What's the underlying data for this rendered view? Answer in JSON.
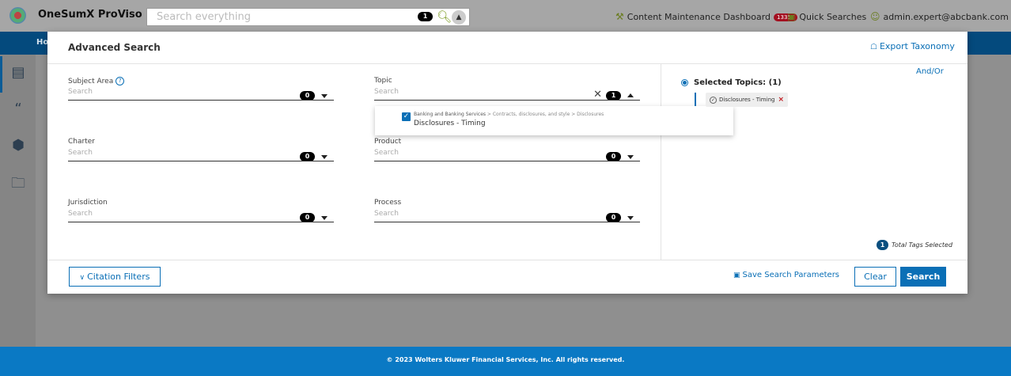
{
  "app": {
    "title": "OneSumX ProViso"
  },
  "global_search": {
    "placeholder": "Search everything",
    "count": "1"
  },
  "topbar": {
    "dashboard_label": "Content Maintenance Dashboard",
    "dashboard_count": "13357",
    "quick_searches_label": "Quick Searches",
    "user_email": "admin.expert@abcbank.com"
  },
  "nav": {
    "home_label": "Ho"
  },
  "modal": {
    "title": "Advanced Search",
    "export_label": "Export Taxonomy",
    "fields": {
      "subject_area": {
        "label": "Subject Area",
        "placeholder": "Search",
        "count": "0"
      },
      "topic": {
        "label": "Topic",
        "placeholder": "Search",
        "count": "1"
      },
      "charter": {
        "label": "Charter",
        "placeholder": "Search",
        "count": "0"
      },
      "product": {
        "label": "Product",
        "placeholder": "Search",
        "count": "0"
      },
      "jurisdiction": {
        "label": "Jurisdiction",
        "placeholder": "Search",
        "count": "0"
      },
      "process": {
        "label": "Process",
        "placeholder": "Search",
        "count": "0"
      }
    },
    "topic_dropdown": {
      "path_root": "Banking and Banking Services",
      "path_rest": " > Contracts, disclosures, and style > Disclosures",
      "item": "Disclosures - Timing",
      "checked": true
    },
    "selected": {
      "and_or_label": "And/Or",
      "title": "Selected Topics: (1)",
      "tags": [
        "Disclosures - Timing"
      ],
      "total_count": "1",
      "total_label": "Total Tags Selected"
    },
    "footer": {
      "citation_label": "Citation Filters",
      "save_label": "Save Search Parameters",
      "clear_label": "Clear",
      "search_label": "Search"
    }
  },
  "copyright": "© 2023 Wolters Kluwer Financial Services, Inc. All rights reserved.",
  "colors": {
    "accent": "#0a6fb6",
    "nav": "#044a7d",
    "footer": "#0a79c4",
    "badge_red": "#a30e20"
  }
}
